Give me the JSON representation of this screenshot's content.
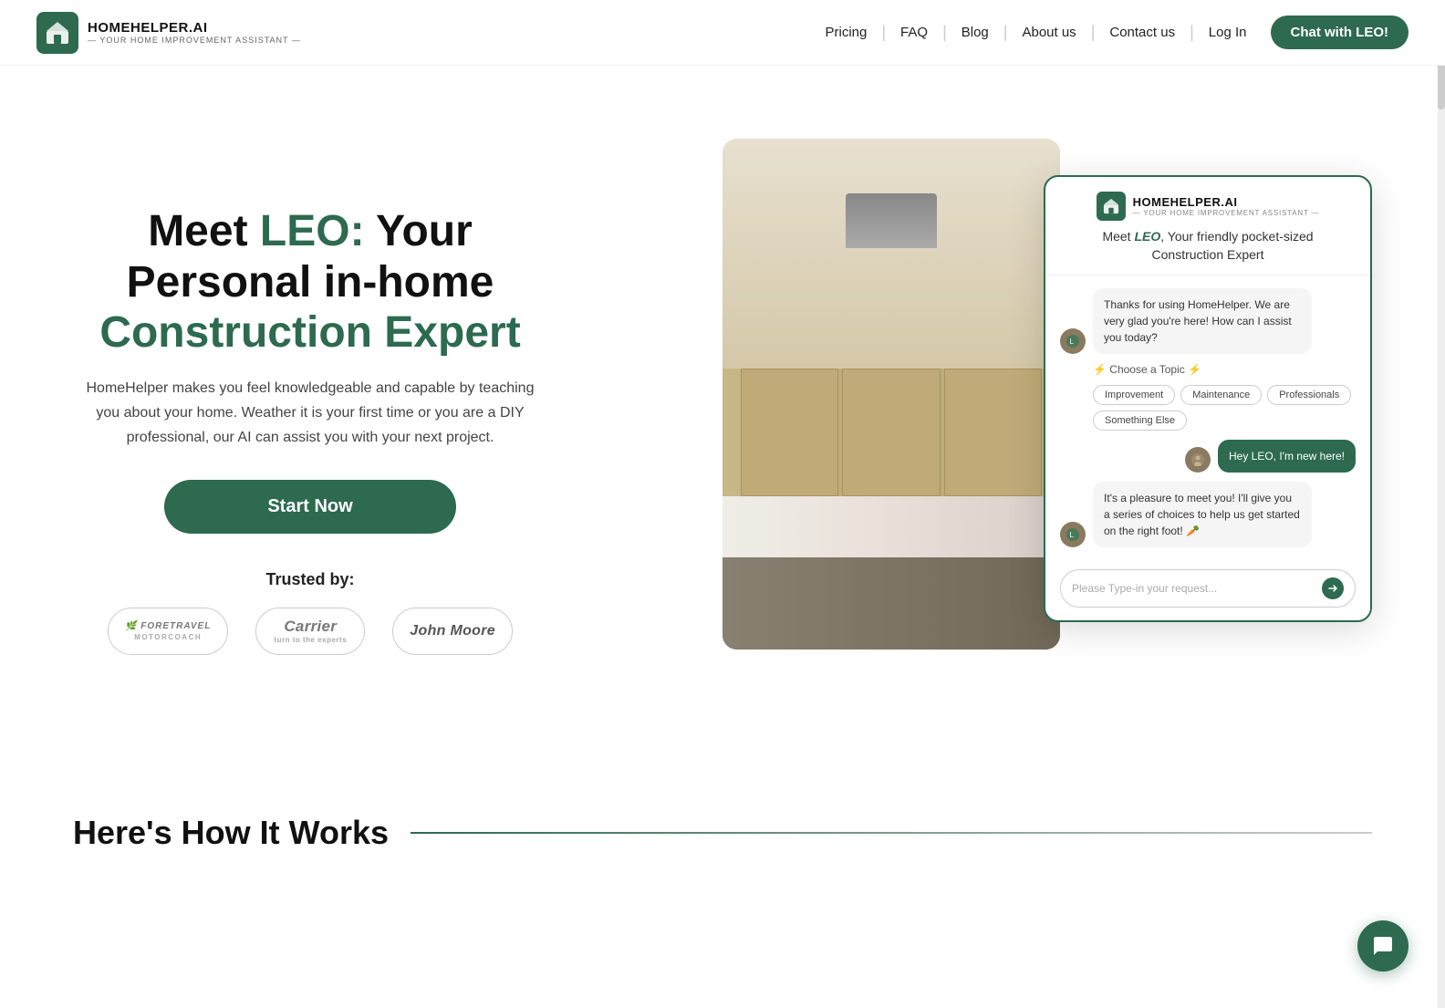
{
  "brand": {
    "name": "HOMEHELPER.AI",
    "tagline": "— YOUR HOME IMPROVEMENT ASSISTANT —",
    "icon_alt": "home-helper-logo"
  },
  "nav": {
    "links": [
      {
        "label": "Pricing",
        "id": "pricing"
      },
      {
        "label": "FAQ",
        "id": "faq"
      },
      {
        "label": "Blog",
        "id": "blog"
      },
      {
        "label": "About us",
        "id": "about"
      },
      {
        "label": "Contact us",
        "id": "contact"
      },
      {
        "label": "Log In",
        "id": "login"
      }
    ],
    "cta_label": "Chat with LEO!"
  },
  "hero": {
    "title_prefix": "Meet ",
    "title_leo": "LEO:",
    "title_mid": " Your Personal in-home ",
    "title_green": "Construction Expert",
    "description": "HomeHelper makes you feel knowledgeable and capable by teaching you about your home. Weather it is your first time or you are a DIY professional, our AI can assist you with your next project.",
    "cta_label": "Start Now",
    "trusted_label": "Trusted by:",
    "logos": [
      {
        "id": "foretravel",
        "line1": "FORETRAVEL",
        "line2": "MOTORCOACH"
      },
      {
        "id": "carrier",
        "text": "Carrier\nturn to the experts"
      },
      {
        "id": "johnmoore",
        "text": "John Moore"
      }
    ]
  },
  "chat_card": {
    "brand": "HOMEHELPER.AI",
    "brand_sub": "— YOUR HOME IMPROVEMENT ASSISTANT —",
    "intro": "Meet LEO, Your friendly pocket-sized Construction Expert",
    "messages": [
      {
        "side": "left",
        "text": "Thanks for using HomeHelper. We are very glad you're here! How can I assist you today?"
      },
      {
        "side": "topic",
        "text": "⚡ Choose a Topic ⚡"
      },
      {
        "side": "chips",
        "items": [
          "Improvement",
          "Maintenance",
          "Professionals",
          "Something Else"
        ]
      },
      {
        "side": "right",
        "text": "Hey LEO, I'm new here!"
      },
      {
        "side": "left",
        "text": "It's a pleasure to meet you! I'll give you a series of choices to help us get started on the right foot! 🥕"
      }
    ],
    "input_placeholder": "Please Type-in your request..."
  },
  "how_it_works": {
    "title": "Here's How It Works"
  },
  "fab": {
    "icon": "chat-icon"
  }
}
